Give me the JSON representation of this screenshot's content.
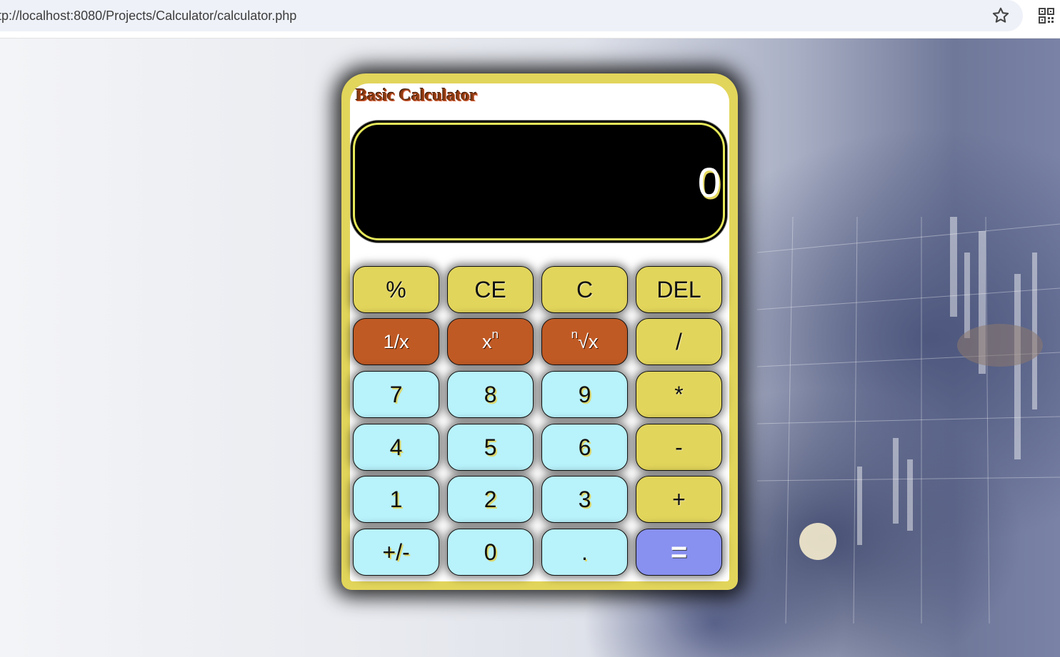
{
  "browser": {
    "url": "http://localhost:8080/Projects/Calculator/calculator.php",
    "icons": [
      "star-icon",
      "qr-code-icon"
    ]
  },
  "calculator": {
    "title": "Basic Calculator",
    "display_value": "0",
    "colors": {
      "frame": "#e2d55b",
      "function_key": "#e2d55b",
      "power_key": "#c05a24",
      "digit_key": "#b8f2fb",
      "equals_key": "#8890f0",
      "display_bg": "#000000"
    },
    "rows": [
      [
        "%",
        "CE",
        "C",
        "DEL"
      ],
      [
        "1/x",
        "x^n",
        "n√x",
        "/"
      ],
      [
        "7",
        "8",
        "9",
        "*"
      ],
      [
        "4",
        "5",
        "6",
        "-"
      ],
      [
        "1",
        "2",
        "3",
        "+"
      ],
      [
        "+/-",
        "0",
        ".",
        "="
      ]
    ],
    "keys": {
      "percent": "%",
      "ce": "CE",
      "c": "C",
      "del": "DEL",
      "reciprocal": "1/x",
      "power_base": "x",
      "power_exp": "n",
      "root_index": "n",
      "root_body": "√x",
      "divide": "/",
      "seven": "7",
      "eight": "8",
      "nine": "9",
      "multiply": "*",
      "four": "4",
      "five": "5",
      "six": "6",
      "minus": "-",
      "one": "1",
      "two": "2",
      "three": "3",
      "plus": "+",
      "negate": "+/-",
      "zero": "0",
      "decimal": ".",
      "equals": "="
    }
  }
}
